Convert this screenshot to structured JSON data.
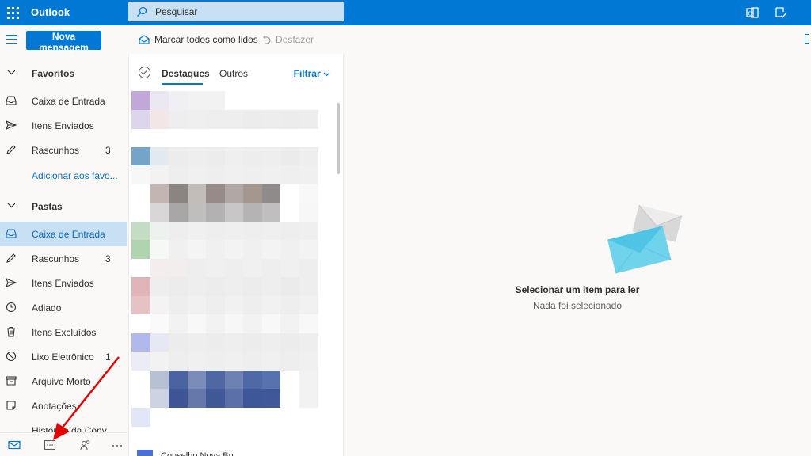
{
  "app": {
    "brand": "Outlook"
  },
  "search": {
    "placeholder": "Pesquisar"
  },
  "toolbar": {
    "new_message": "Nova mensagem",
    "mark_all_read": "Marcar todos como lidos",
    "undo": "Desfazer"
  },
  "sidebar": {
    "favorites": {
      "title": "Favoritos",
      "items": [
        {
          "label": "Caixa de Entrada",
          "count": ""
        },
        {
          "label": "Itens Enviados",
          "count": ""
        },
        {
          "label": "Rascunhos",
          "count": "3"
        }
      ],
      "add_link": "Adicionar aos favo..."
    },
    "folders": {
      "title": "Pastas",
      "items": [
        {
          "label": "Caixa de Entrada",
          "count": "",
          "selected": true
        },
        {
          "label": "Rascunhos",
          "count": "3"
        },
        {
          "label": "Itens Enviados",
          "count": ""
        },
        {
          "label": "Adiado",
          "count": ""
        },
        {
          "label": "Itens Excluídos",
          "count": ""
        },
        {
          "label": "Lixo Eletrônico",
          "count": "1"
        },
        {
          "label": "Arquivo Morto",
          "count": ""
        },
        {
          "label": "Anotações",
          "count": ""
        },
        {
          "label": "Histórico da Conv...",
          "count": ""
        }
      ]
    }
  },
  "message_list": {
    "tabs": [
      {
        "label": "Destaques",
        "active": true
      },
      {
        "label": "Outros",
        "active": false
      }
    ],
    "filter": "Filtrar",
    "peek_sender": "Conselho Nova Bu..."
  },
  "reading_pane": {
    "title": "Selecionar um item para ler",
    "subtitle": "Nada foi selecionado"
  },
  "colors": {
    "accent": "#0078d4",
    "selected": "#c7e0f4",
    "annotation": "#e00000"
  }
}
